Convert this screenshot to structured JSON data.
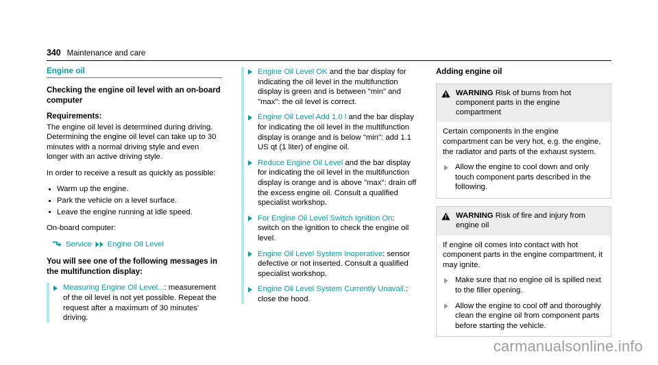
{
  "header": {
    "page_number": "340",
    "title": "Maintenance and care"
  },
  "left_column": {
    "section_title": "Engine oil",
    "h2": "Checking the engine oil level with an on-board computer",
    "requirements_label": "Requirements:",
    "requirements_text": "The engine oil level is determined during driving. Determining the engine oil level can take up to 30 minutes with a normal driving style and even longer with an active driving style.",
    "result_intro": "In order to receive a result as quickly as possible:",
    "bullets": [
      "Warm up the engine.",
      "Park the vehicle on a level surface.",
      "Leave the engine running at idle speed."
    ],
    "obc_label": "On-board computer:",
    "nav_path": {
      "first": "Service",
      "second": "Engine Oil Level",
      "first_icon": "turn-arrow-icon",
      "second_icon": "double-chevron-icon"
    },
    "messages_intro": "You will see one of the following messages in the multifunction display:",
    "actions": [
      {
        "mfd": "Measuring Engine Oil Level...",
        "text": ": measurement of the oil level is not yet possible. Repeat the request after a maximum of 30 minutes' driving."
      }
    ]
  },
  "middle_column": {
    "actions": [
      {
        "mfd": "Engine Oil Level OK",
        "text": " and the bar display for indicating the oil level in the multifunction display is green and is between \"min\" and \"max\": the oil level is correct."
      },
      {
        "mfd": "Engine Oil Level Add 1.0 l",
        "text": " and the bar display for indicating the oil level in the multifunction display is orange and is below \"min\": add 1.1 US qt (1 liter) of engine oil."
      },
      {
        "mfd": "Reduce Engine Oil Level",
        "text": " and the bar display for indicating the oil level in the multifunction display is orange and is above \"max\": drain off the excess engine oil. Consult a qualified specialist workshop."
      },
      {
        "mfd": "For Engine Oil Level Switch Ignition On",
        "text": ": switch on the ignition to check the engine oil level."
      },
      {
        "mfd": "Engine Oil Level System Inoperative",
        "text": ": sensor defective or not inserted. Consult a qualified specialist workshop."
      },
      {
        "mfd": "Engine Oil Level System Currently Unavail.",
        "text": ": close the hood."
      }
    ]
  },
  "right_column": {
    "h2": "Adding engine oil",
    "warnings": [
      {
        "symbol": "warning-triangle-icon",
        "label": "WARNING",
        "title": " Risk of burns from hot component parts in the engine compartment",
        "body": "Certain components in the engine compartment can be very hot, e.g. the engine, the radiator and parts of the exhaust system.",
        "actions": [
          "Allow the engine to cool down and only touch component parts described in the following."
        ]
      },
      {
        "symbol": "warning-triangle-icon",
        "label": "WARNING",
        "title": " Risk of fire and injury from engine oil",
        "body": "If engine oil comes into contact with hot component parts in the engine compartment, it may ignite.",
        "actions": [
          "Make sure that no engine oil is spilled next to the filler opening.",
          "Allow the engine to cool off and thoroughly clean the engine oil from component parts before starting the vehicle."
        ]
      }
    ]
  },
  "watermark": "carmanualsonline.info",
  "colors": {
    "accent_teal": "#00a0a8",
    "marker_teal": "#aeeaea",
    "warning_header_bg": "#ececec",
    "warning_border": "#d2d2d2",
    "watermark_gray": "#9d9d9d"
  }
}
